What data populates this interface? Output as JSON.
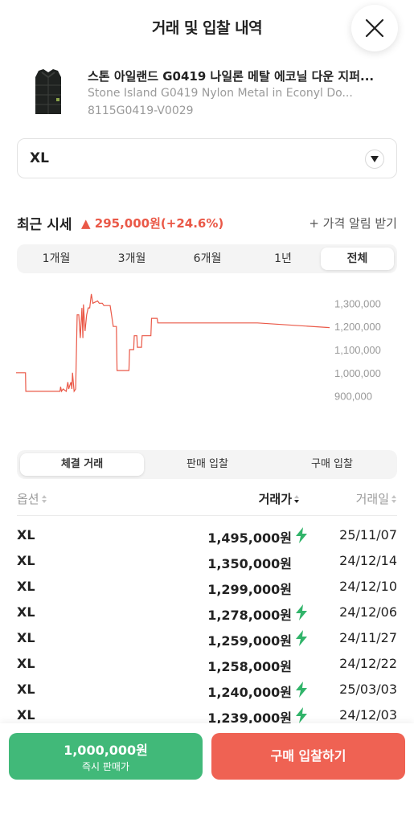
{
  "header": {
    "title": "거래 및 입찰 내역"
  },
  "product": {
    "title_ko": "스톤 아일랜드 G0419 나일론 메탈 에코닐 다운 지퍼...",
    "title_en": "Stone Island G0419 Nylon Metal in Econyl Do...",
    "code": "8115G0419-V0029"
  },
  "size_select": {
    "value": "XL"
  },
  "price_summary": {
    "label": "최근 시세",
    "change": "295,000원(+24.6%)",
    "alert_link": "+ 가격 알림 받기"
  },
  "period_tabs": [
    {
      "label": "1개월",
      "active": false
    },
    {
      "label": "3개월",
      "active": false
    },
    {
      "label": "6개월",
      "active": false
    },
    {
      "label": "1년",
      "active": false
    },
    {
      "label": "전체",
      "active": true
    }
  ],
  "chart_data": {
    "type": "line",
    "y_tick_labels": [
      "1,300,000",
      "1,200,000",
      "1,100,000",
      "1,000,000",
      "900,000"
    ],
    "y_ticks": [
      1300000,
      1200000,
      1100000,
      1000000,
      900000
    ],
    "ylim": [
      840000,
      1360000
    ],
    "color": "#ea5847",
    "points": [
      [
        0.0,
        1000000
      ],
      [
        0.03,
        1000000
      ],
      [
        0.031,
        920000
      ],
      [
        0.14,
        920000
      ],
      [
        0.142,
        940000
      ],
      [
        0.145,
        920000
      ],
      [
        0.15,
        930000
      ],
      [
        0.16,
        920000
      ],
      [
        0.165,
        960000
      ],
      [
        0.168,
        930000
      ],
      [
        0.17,
        940000
      ],
      [
        0.175,
        960000
      ],
      [
        0.178,
        930000
      ],
      [
        0.18,
        1000000
      ],
      [
        0.185,
        920000
      ],
      [
        0.19,
        930000
      ],
      [
        0.195,
        1250000
      ],
      [
        0.2,
        1250000
      ],
      [
        0.205,
        1150000
      ],
      [
        0.21,
        1280000
      ],
      [
        0.213,
        1150000
      ],
      [
        0.215,
        1295000
      ],
      [
        0.22,
        1180000
      ],
      [
        0.225,
        1250000
      ],
      [
        0.23,
        1280000
      ],
      [
        0.235,
        1280000
      ],
      [
        0.24,
        1340000
      ],
      [
        0.245,
        1300000
      ],
      [
        0.26,
        1310000
      ],
      [
        0.265,
        1300000
      ],
      [
        0.275,
        1300000
      ],
      [
        0.28,
        1290000
      ],
      [
        0.3,
        1290000
      ],
      [
        0.31,
        1200000
      ],
      [
        0.32,
        1200000
      ],
      [
        0.322,
        1010000
      ],
      [
        0.36,
        1010000
      ],
      [
        0.362,
        1100000
      ],
      [
        0.375,
        1100000
      ],
      [
        0.377,
        1160000
      ],
      [
        0.385,
        1160000
      ],
      [
        0.387,
        1110000
      ],
      [
        0.4,
        1110000
      ],
      [
        0.402,
        1160000
      ],
      [
        0.43,
        1160000
      ],
      [
        0.432,
        1235000
      ],
      [
        0.45,
        1235000
      ],
      [
        0.452,
        1215000
      ],
      [
        0.77,
        1215000
      ],
      [
        1.0,
        1195000
      ]
    ]
  },
  "trade_tabs": [
    {
      "label": "체결 거래",
      "active": true
    },
    {
      "label": "판매 입찰",
      "active": false
    },
    {
      "label": "구매 입찰",
      "active": false
    }
  ],
  "table": {
    "headers": {
      "option": "옵션",
      "price": "거래가",
      "date": "거래일"
    },
    "rows": [
      {
        "option": "XL",
        "price": "1,495,000원",
        "fast": true,
        "date": "25/11/07"
      },
      {
        "option": "XL",
        "price": "1,350,000원",
        "fast": false,
        "date": "24/12/14"
      },
      {
        "option": "XL",
        "price": "1,299,000원",
        "fast": false,
        "date": "24/12/10"
      },
      {
        "option": "XL",
        "price": "1,278,000원",
        "fast": true,
        "date": "24/12/06"
      },
      {
        "option": "XL",
        "price": "1,259,000원",
        "fast": true,
        "date": "24/11/27"
      },
      {
        "option": "XL",
        "price": "1,258,000원",
        "fast": false,
        "date": "24/12/22"
      },
      {
        "option": "XL",
        "price": "1,240,000원",
        "fast": true,
        "date": "25/03/03"
      },
      {
        "option": "XL",
        "price": "1,239,000원",
        "fast": true,
        "date": "24/12/03"
      }
    ]
  },
  "bottom": {
    "sell_price": "1,000,000원",
    "sell_label": "즉시 판매가",
    "buy_label": "구매 입찰하기"
  }
}
